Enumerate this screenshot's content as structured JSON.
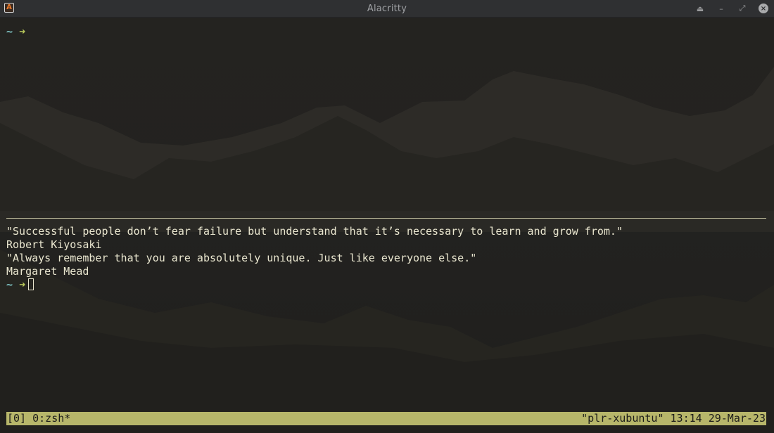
{
  "window": {
    "title": "Alacritty",
    "app_icon_letter": "A",
    "controls": {
      "keep_above_icon": "⏏",
      "minimize_icon": "–",
      "maximize_icon": "⤢",
      "close_icon": "×"
    }
  },
  "terminal": {
    "prompt_tilde": "~",
    "prompt_arrow": "➜",
    "lines": [
      "\"Successful people don’t fear failure but understand that it’s necessary to learn and grow from.\"",
      "Robert Kiyosaki",
      "\"Always remember that you are absolutely unique. Just like everyone else.\"",
      "Margaret Mead"
    ]
  },
  "tmux": {
    "left": "[0] 0:zsh*",
    "right": "\"plr-xubuntu\" 13:14 29-Mar-23"
  },
  "colors": {
    "background": "#222220",
    "foreground": "#e9e6cf",
    "prompt_tilde": "#7ec4c4",
    "prompt_arrow": "#b8c85a",
    "status_bar": "#b7b66a"
  }
}
